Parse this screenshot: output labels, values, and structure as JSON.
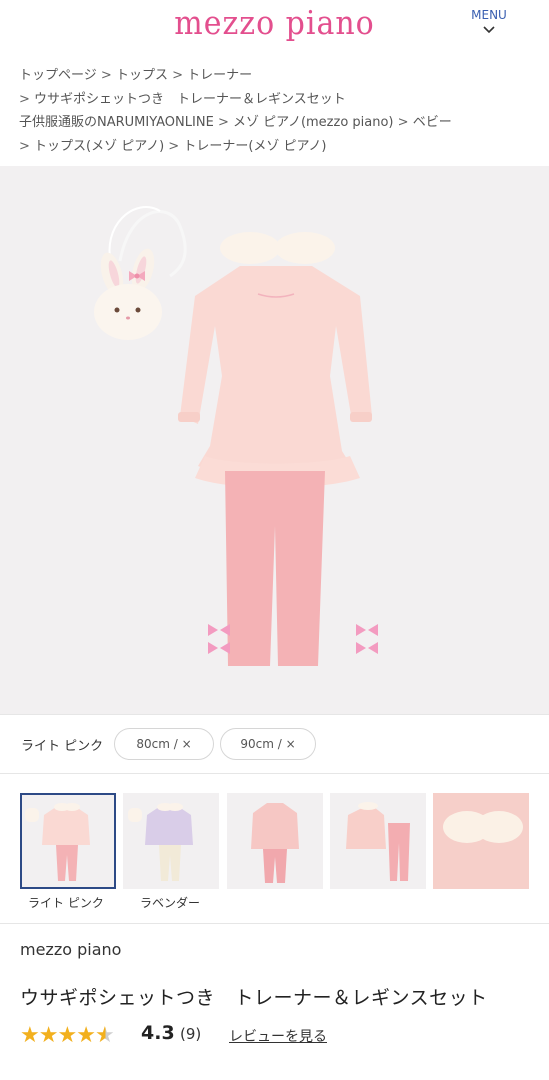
{
  "header": {
    "logo": "mezzo piano",
    "menu_label": "MENU"
  },
  "breadcrumb": {
    "items": [
      "トップページ",
      "トップス",
      "トレーナー",
      "ウサギポシェットつき　トレーナー＆レギンスセット",
      "子供服通販のNARUMIYAONLINE",
      "メゾ ピアノ(mezzo piano)",
      "ベビー",
      "トップス(メゾ ピアノ)",
      "トレーナー(メゾ ピアノ)"
    ],
    "separator": ">"
  },
  "product": {
    "color_name": "ライト ピンク",
    "sizes": [
      "80cm / ×",
      "90cm / ×"
    ],
    "thumbnails": [
      {
        "label": "ライト ピンク",
        "selected": true
      },
      {
        "label": "ラベンダー",
        "selected": false
      },
      {
        "label": "",
        "selected": false
      },
      {
        "label": "",
        "selected": false
      },
      {
        "label": "",
        "selected": false
      }
    ],
    "brand": "mezzo piano",
    "title": "ウサギポシェットつき　トレーナー＆レギンスセット",
    "rating": "4.3",
    "rating_stars": 4.5,
    "review_count": "(9)",
    "review_link": "レビューを見る"
  },
  "colors": {
    "logo": "#e34f8e",
    "menu": "#3a5fb0",
    "star": "#f2b01e",
    "image_bg": "#f2f0f1",
    "selected_border": "#2d4a86"
  }
}
